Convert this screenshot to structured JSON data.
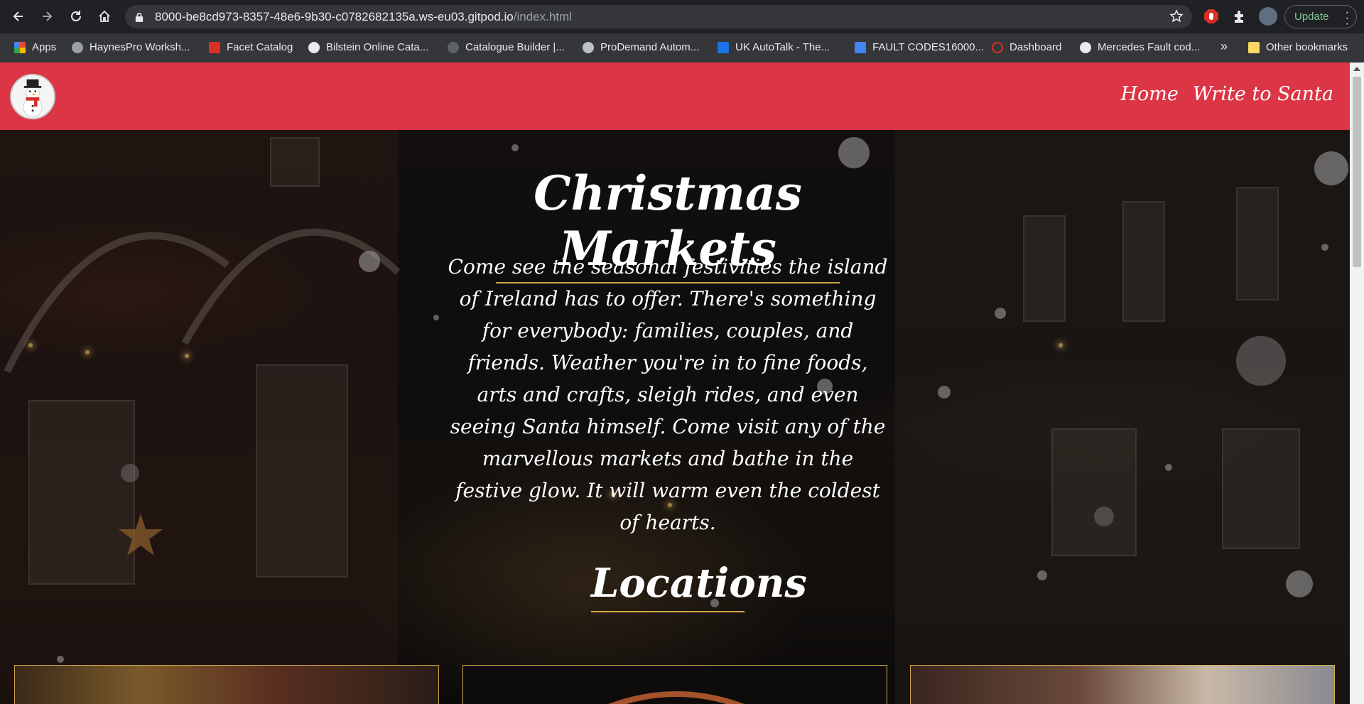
{
  "browser": {
    "url_host": "8000-be8cd973-8357-48e6-9b30-c0782682135a.ws-eu03.gitpod.io",
    "url_path": "/index.html",
    "update_label": "Update"
  },
  "bookmarks": [
    {
      "label": "Apps",
      "icon": "apps-grid-icon",
      "color": "#ea4335"
    },
    {
      "label": "HaynesPro Worksh...",
      "icon": "haynespro-icon",
      "color": "#9aa0a6"
    },
    {
      "label": "Facet Catalog",
      "icon": "facet-icon",
      "color": "#d93025"
    },
    {
      "label": "Bilstein Online Cata...",
      "icon": "globe-icon",
      "color": "#e8eaed"
    },
    {
      "label": "Catalogue Builder |...",
      "icon": "catalogue-icon",
      "color": "#5f6368"
    },
    {
      "label": "ProDemand Autom...",
      "icon": "prodemand-icon",
      "color": "#bdc1c6"
    },
    {
      "label": "UK AutoTalk - The...",
      "icon": "autotalk-icon",
      "color": "#1a73e8"
    },
    {
      "label": "FAULT CODES16000...",
      "icon": "faultcodes-icon",
      "color": "#4285f4"
    },
    {
      "label": "Dashboard",
      "icon": "dashboard-icon",
      "color": "#d93025"
    },
    {
      "label": "Mercedes Fault cod...",
      "icon": "globe-icon",
      "color": "#e8eaed"
    }
  ],
  "bookmarks_overflow": "»",
  "other_bookmarks": "Other bookmarks",
  "site": {
    "nav": [
      {
        "label": "Home"
      },
      {
        "label": "Write to Santa"
      }
    ],
    "header_color": "#dc3545",
    "accent_color": "#d4a94a",
    "title": "Christmas Markets",
    "intro": "Come see the seasonal festivities the island of Ireland has to offer. There's something for everybody: families, couples, and friends. Weather you're in to fine foods, arts and crafts, sleigh rides, and even seeing Santa himself. Come visit any of the marvellous markets and bathe in the festive glow. It will warm even the coldest of hearts.",
    "locations_heading": "Locations"
  }
}
